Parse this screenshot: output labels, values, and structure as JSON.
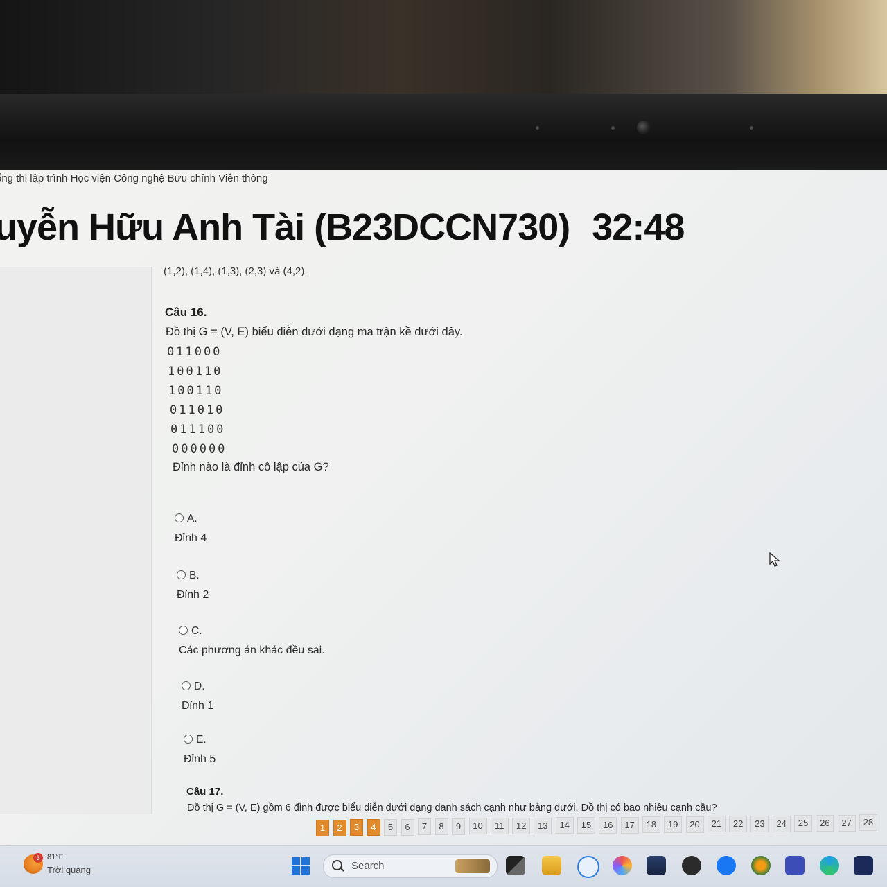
{
  "site": {
    "title": "ổng thi lập trình Học viện Công nghệ Bưu chính Viễn thông"
  },
  "exam": {
    "user_name": "uyễn Hữu Anh Tài (B23DCCN730)",
    "timer": "32:48"
  },
  "previous_question_tail": "(1,2), (1,4), (1,3), (2,3) và (4,2).",
  "question16": {
    "label": "Câu 16.",
    "prompt": "Đồ thị G = (V, E) biểu diễn dưới dạng ma trận kề dưới đây.",
    "matrix": [
      "011000",
      "100110",
      "100110",
      "011010",
      "011100",
      "000000"
    ],
    "ask": "Đỉnh nào là đỉnh cô lập của G?",
    "options": [
      {
        "letter": "A.",
        "text": "Đỉnh 4"
      },
      {
        "letter": "B.",
        "text": "Đỉnh 2"
      },
      {
        "letter": "C.",
        "text": "Các phương án khác đều sai."
      },
      {
        "letter": "D.",
        "text": "Đỉnh 1"
      },
      {
        "letter": "E.",
        "text": "Đỉnh 5"
      }
    ]
  },
  "question17": {
    "label": "Câu 17.",
    "text": "Đồ thị G = (V, E) gồm 6 đỉnh được biểu diễn dưới dạng danh sách cạnh như bảng dưới. Đồ thị có bao nhiêu cạnh cầu?"
  },
  "question_nav": {
    "numbers": [
      "1",
      "2",
      "3",
      "4",
      "5",
      "6",
      "7",
      "8",
      "9",
      "10",
      "11",
      "12",
      "13",
      "14",
      "15",
      "16",
      "17",
      "18",
      "19",
      "20",
      "21",
      "22",
      "23",
      "24",
      "25",
      "26",
      "27",
      "28"
    ],
    "answered": [
      "1",
      "2",
      "3",
      "4"
    ],
    "answered_color": "#e18b2c"
  },
  "taskbar": {
    "weather_badge": "3",
    "weather_temp": "81°F",
    "weather_desc": "Trời quang",
    "search_label": "Search",
    "icons": [
      "start-icon",
      "search-icon",
      "widget-icon",
      "task-view-icon",
      "file-explorer-icon",
      "zalo-icon",
      "copilot-icon",
      "store-icon",
      "xbox-icon",
      "facebook-icon",
      "app-icon",
      "camera-app-icon",
      "edge-icon",
      "dev-app-icon"
    ]
  }
}
